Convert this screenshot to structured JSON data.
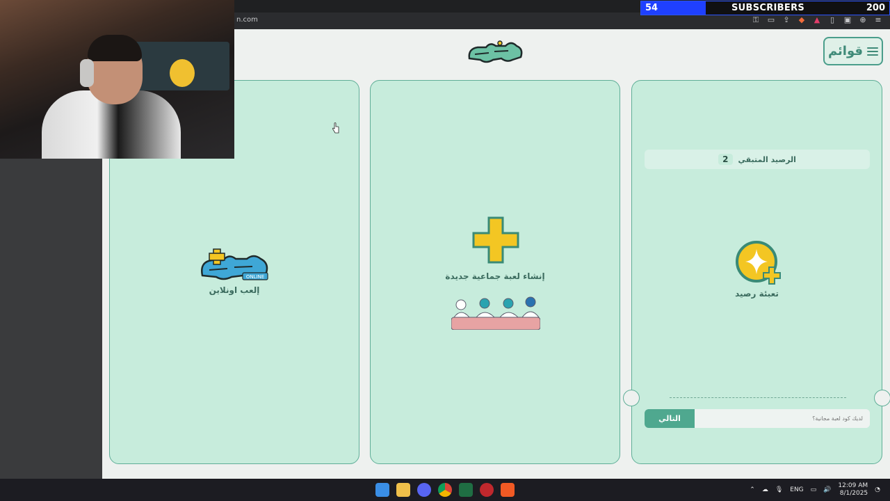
{
  "browser": {
    "url": "n.com"
  },
  "overlay": {
    "subscribers_current": "54",
    "subscribers_label": "SUBSCRIBERS",
    "subscribers_goal": "200"
  },
  "header": {
    "menu_label": "قوائم"
  },
  "cards": {
    "online": {
      "label": "إلعب اونلاين",
      "logo_badge": "ONLINE"
    },
    "create": {
      "label": "إنشاء لعبة جماعية جديدة"
    },
    "recharge": {
      "balance_label": "الرصيد المتبقي",
      "balance_value": "2",
      "label": "تعبئة رصيد",
      "next_button": "التالي",
      "code_placeholder": "لديك كود لعبة مجانية؟"
    }
  },
  "taskbar": {
    "lang": "ENG",
    "time": "12:09 AM",
    "date": "8/1/2025"
  },
  "colors": {
    "card_bg": "#c7ecdc",
    "card_border": "#5fae97",
    "accent_teal": "#4fa88f",
    "accent_yellow": "#f3c623"
  }
}
